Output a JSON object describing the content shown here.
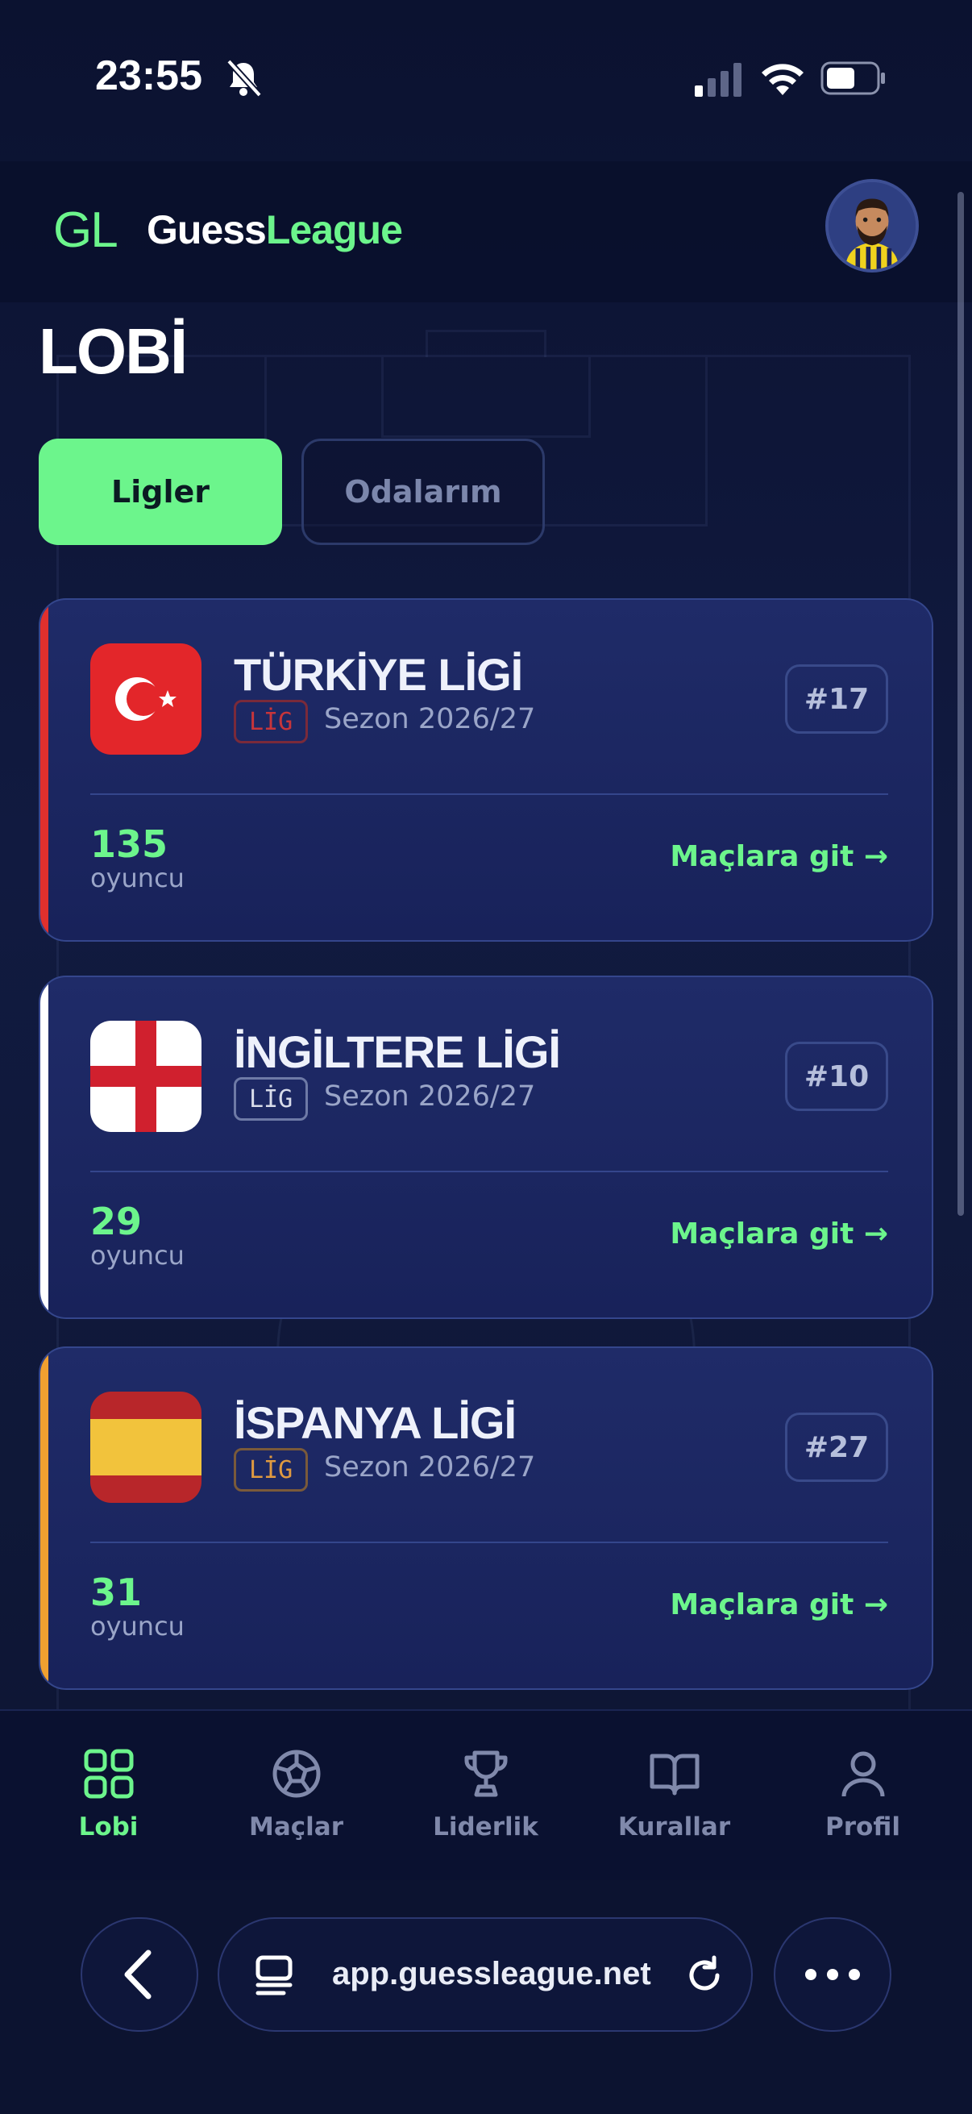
{
  "status_bar": {
    "time": "23:55"
  },
  "header": {
    "logo_mark": "GL",
    "brand_part1": "Guess",
    "brand_part2": "League"
  },
  "page": {
    "title": "LOBİ"
  },
  "tabs": [
    {
      "label": "Ligler",
      "active": true
    },
    {
      "label": "Odalarım",
      "active": false
    }
  ],
  "leagues": [
    {
      "name": "TÜRKİYE LİGİ",
      "tag": "LİG",
      "season": "Sezon 2026/27",
      "rank": "#17",
      "count": "135",
      "count_label": "oyuncu",
      "action": "Maçlara git →",
      "accent": "#e0302d",
      "tag_color": "#b8302d"
    },
    {
      "name": "İNGİLTERE LİGİ",
      "tag": "LİG",
      "season": "Sezon 2026/27",
      "rank": "#10",
      "count": "29",
      "count_label": "oyuncu",
      "action": "Maçlara git →",
      "accent": "#ffffff",
      "tag_color": "#c8cde0"
    },
    {
      "name": "İSPANYA LİGİ",
      "tag": "LİG",
      "season": "Sezon 2026/27",
      "rank": "#27",
      "count": "31",
      "count_label": "oyuncu",
      "action": "Maçlara git →",
      "accent": "#f0a030",
      "tag_color": "#d08a36"
    }
  ],
  "bottom_nav": [
    {
      "label": "Lobi",
      "icon": "grid-icon",
      "active": true
    },
    {
      "label": "Maçlar",
      "icon": "soccer-ball-icon",
      "active": false
    },
    {
      "label": "Liderlik",
      "icon": "trophy-icon",
      "active": false
    },
    {
      "label": "Kurallar",
      "icon": "book-icon",
      "active": false
    },
    {
      "label": "Profil",
      "icon": "user-icon",
      "active": false
    }
  ],
  "browser": {
    "url": "app.guessleague.net"
  },
  "colors": {
    "accent_green": "#6cf58c",
    "background": "#0c1330",
    "card": "#1f2b68"
  }
}
